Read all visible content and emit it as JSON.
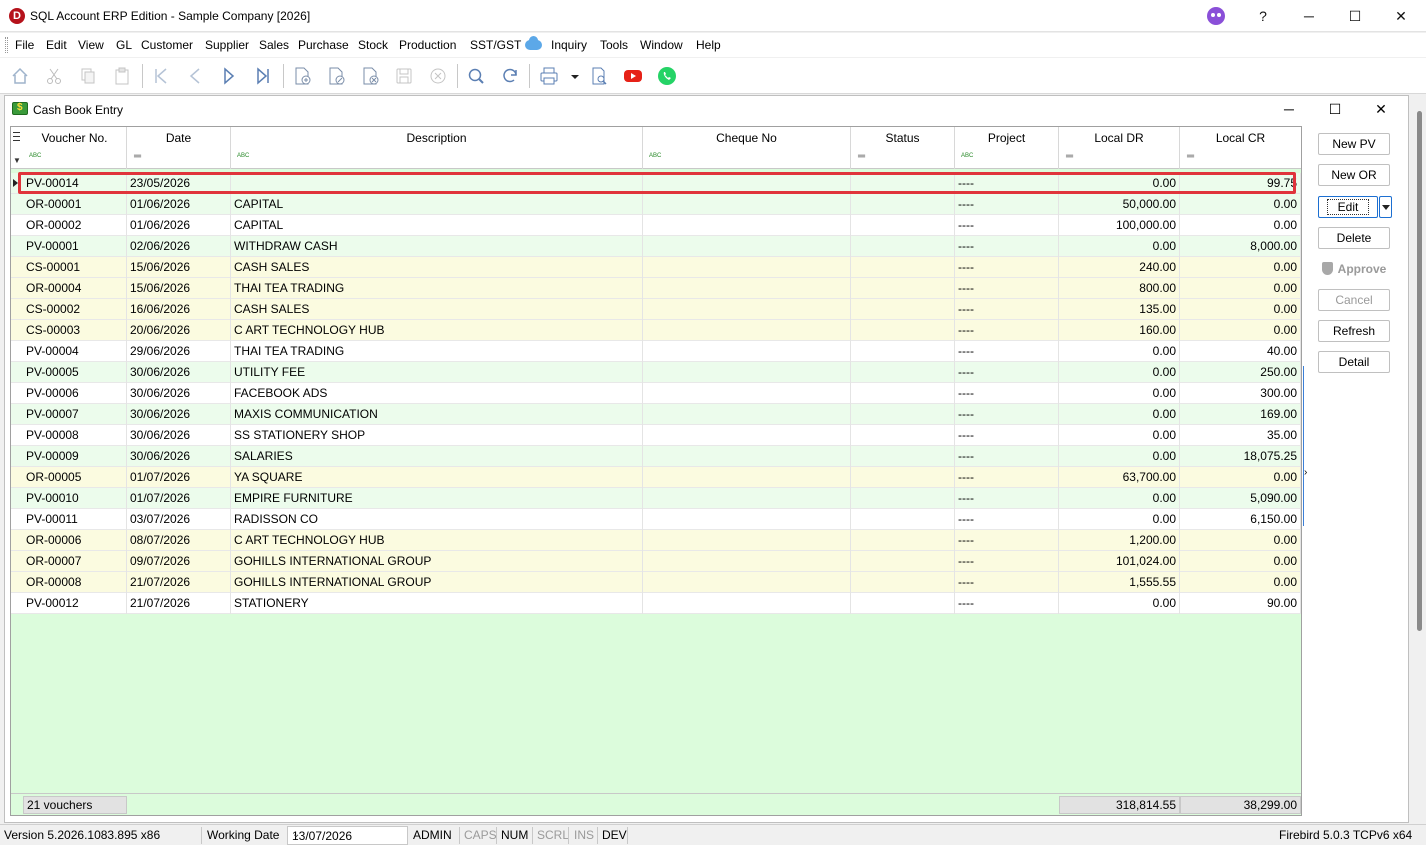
{
  "window": {
    "title": "SQL Account ERP Edition - Sample Company [2026]",
    "help_label": "?",
    "minimize": "─",
    "maximize": "☐",
    "close": "✕"
  },
  "menu": [
    "File",
    "Edit",
    "View",
    "GL",
    "Customer",
    "Supplier",
    "Sales",
    "Purchase",
    "Stock",
    "Production",
    "SST/GST",
    "Inquiry",
    "Tools",
    "Window",
    "Help"
  ],
  "toolbar_icons": [
    "home-icon",
    "cut-icon",
    "copy-icon",
    "paste-icon",
    "first-record-icon",
    "previous-record-icon",
    "next-record-icon",
    "last-record-icon",
    "new-document-icon",
    "edit-document-icon",
    "delete-document-icon",
    "save-icon",
    "cancel-icon",
    "search-icon",
    "refresh-icon",
    "print-icon",
    "print-preview-icon",
    "youtube-icon",
    "whatsapp-icon"
  ],
  "child": {
    "title": "Cash Book Entry",
    "minimize": "─",
    "maximize": "☐",
    "close": "✕"
  },
  "grid": {
    "columns": [
      "Voucher No.",
      "Date",
      "Description",
      "Cheque No",
      "Status",
      "Project",
      "Local DR",
      "Local CR"
    ],
    "rows": [
      {
        "voucher": "PV-00014",
        "date": "23/05/2026",
        "desc": "",
        "cheque": "",
        "status": "",
        "project": "----",
        "dr": "0.00",
        "cr": "99.75"
      },
      {
        "voucher": "OR-00001",
        "date": "01/06/2026",
        "desc": "CAPITAL",
        "cheque": "",
        "status": "",
        "project": "----",
        "dr": "50,000.00",
        "cr": "0.00"
      },
      {
        "voucher": "OR-00002",
        "date": "01/06/2026",
        "desc": "CAPITAL",
        "cheque": "",
        "status": "",
        "project": "----",
        "dr": "100,000.00",
        "cr": "0.00"
      },
      {
        "voucher": "PV-00001",
        "date": "02/06/2026",
        "desc": "WITHDRAW CASH",
        "cheque": "",
        "status": "",
        "project": "----",
        "dr": "0.00",
        "cr": "8,000.00"
      },
      {
        "voucher": "CS-00001",
        "date": "15/06/2026",
        "desc": "CASH SALES",
        "cheque": "",
        "status": "",
        "project": "----",
        "dr": "240.00",
        "cr": "0.00"
      },
      {
        "voucher": "OR-00004",
        "date": "15/06/2026",
        "desc": "THAI TEA TRADING",
        "cheque": "",
        "status": "",
        "project": "----",
        "dr": "800.00",
        "cr": "0.00"
      },
      {
        "voucher": "CS-00002",
        "date": "16/06/2026",
        "desc": "CASH SALES",
        "cheque": "",
        "status": "",
        "project": "----",
        "dr": "135.00",
        "cr": "0.00"
      },
      {
        "voucher": "CS-00003",
        "date": "20/06/2026",
        "desc": "C ART TECHNOLOGY HUB",
        "cheque": "",
        "status": "",
        "project": "----",
        "dr": "160.00",
        "cr": "0.00"
      },
      {
        "voucher": "PV-00004",
        "date": "29/06/2026",
        "desc": "THAI TEA TRADING",
        "cheque": "",
        "status": "",
        "project": "----",
        "dr": "0.00",
        "cr": "40.00"
      },
      {
        "voucher": "PV-00005",
        "date": "30/06/2026",
        "desc": "UTILITY FEE",
        "cheque": "",
        "status": "",
        "project": "----",
        "dr": "0.00",
        "cr": "250.00"
      },
      {
        "voucher": "PV-00006",
        "date": "30/06/2026",
        "desc": "FACEBOOK ADS",
        "cheque": "",
        "status": "",
        "project": "----",
        "dr": "0.00",
        "cr": "300.00"
      },
      {
        "voucher": "PV-00007",
        "date": "30/06/2026",
        "desc": "MAXIS COMMUNICATION",
        "cheque": "",
        "status": "",
        "project": "----",
        "dr": "0.00",
        "cr": "169.00"
      },
      {
        "voucher": "PV-00008",
        "date": "30/06/2026",
        "desc": "SS STATIONERY SHOP",
        "cheque": "",
        "status": "",
        "project": "----",
        "dr": "0.00",
        "cr": "35.00"
      },
      {
        "voucher": "PV-00009",
        "date": "30/06/2026",
        "desc": "SALARIES",
        "cheque": "",
        "status": "",
        "project": "----",
        "dr": "0.00",
        "cr": "18,075.25"
      },
      {
        "voucher": "OR-00005",
        "date": "01/07/2026",
        "desc": "YA SQUARE",
        "cheque": "",
        "status": "",
        "project": "----",
        "dr": "63,700.00",
        "cr": "0.00"
      },
      {
        "voucher": "PV-00010",
        "date": "01/07/2026",
        "desc": "EMPIRE FURNITURE",
        "cheque": "",
        "status": "",
        "project": "----",
        "dr": "0.00",
        "cr": "5,090.00"
      },
      {
        "voucher": "PV-00011",
        "date": "03/07/2026",
        "desc": "RADISSON CO",
        "cheque": "",
        "status": "",
        "project": "----",
        "dr": "0.00",
        "cr": "6,150.00"
      },
      {
        "voucher": "OR-00006",
        "date": "08/07/2026",
        "desc": "C ART TECHNOLOGY HUB",
        "cheque": "",
        "status": "",
        "project": "----",
        "dr": "1,200.00",
        "cr": "0.00"
      },
      {
        "voucher": "OR-00007",
        "date": "09/07/2026",
        "desc": "GOHILLS INTERNATIONAL GROUP",
        "cheque": "",
        "status": "",
        "project": "----",
        "dr": "101,024.00",
        "cr": "0.00"
      },
      {
        "voucher": "OR-00008",
        "date": "21/07/2026",
        "desc": "GOHILLS INTERNATIONAL GROUP",
        "cheque": "",
        "status": "",
        "project": "----",
        "dr": "1,555.55",
        "cr": "0.00"
      },
      {
        "voucher": "PV-00012",
        "date": "21/07/2026",
        "desc": "STATIONERY",
        "cheque": "",
        "status": "",
        "project": "----",
        "dr": "0.00",
        "cr": "90.00"
      }
    ],
    "footer": {
      "count": "21 vouchers",
      "total_dr": "318,814.55",
      "total_cr": "38,299.00"
    },
    "row_colors": {
      "even": "#ffffff",
      "cash": "#fbfbe0",
      "green": "#ecfcec",
      "accent": "#e0343b"
    }
  },
  "buttons": {
    "new_pv": "New PV",
    "new_or": "New OR",
    "edit": "Edit",
    "delete": "Delete",
    "approve": "Approve",
    "cancel": "Cancel",
    "refresh": "Refresh",
    "detail": "Detail"
  },
  "status": {
    "version": "Version 5.2026.1083.895 x86",
    "working_date_label": "Working Date",
    "working_date": "13/07/2026",
    "user": "ADMIN",
    "caps": "CAPS",
    "num": "NUM",
    "scrl": "SCRL",
    "ins": "INS",
    "dev": "DEV",
    "db": "Firebird 5.0.3 TCPv6 x64"
  }
}
